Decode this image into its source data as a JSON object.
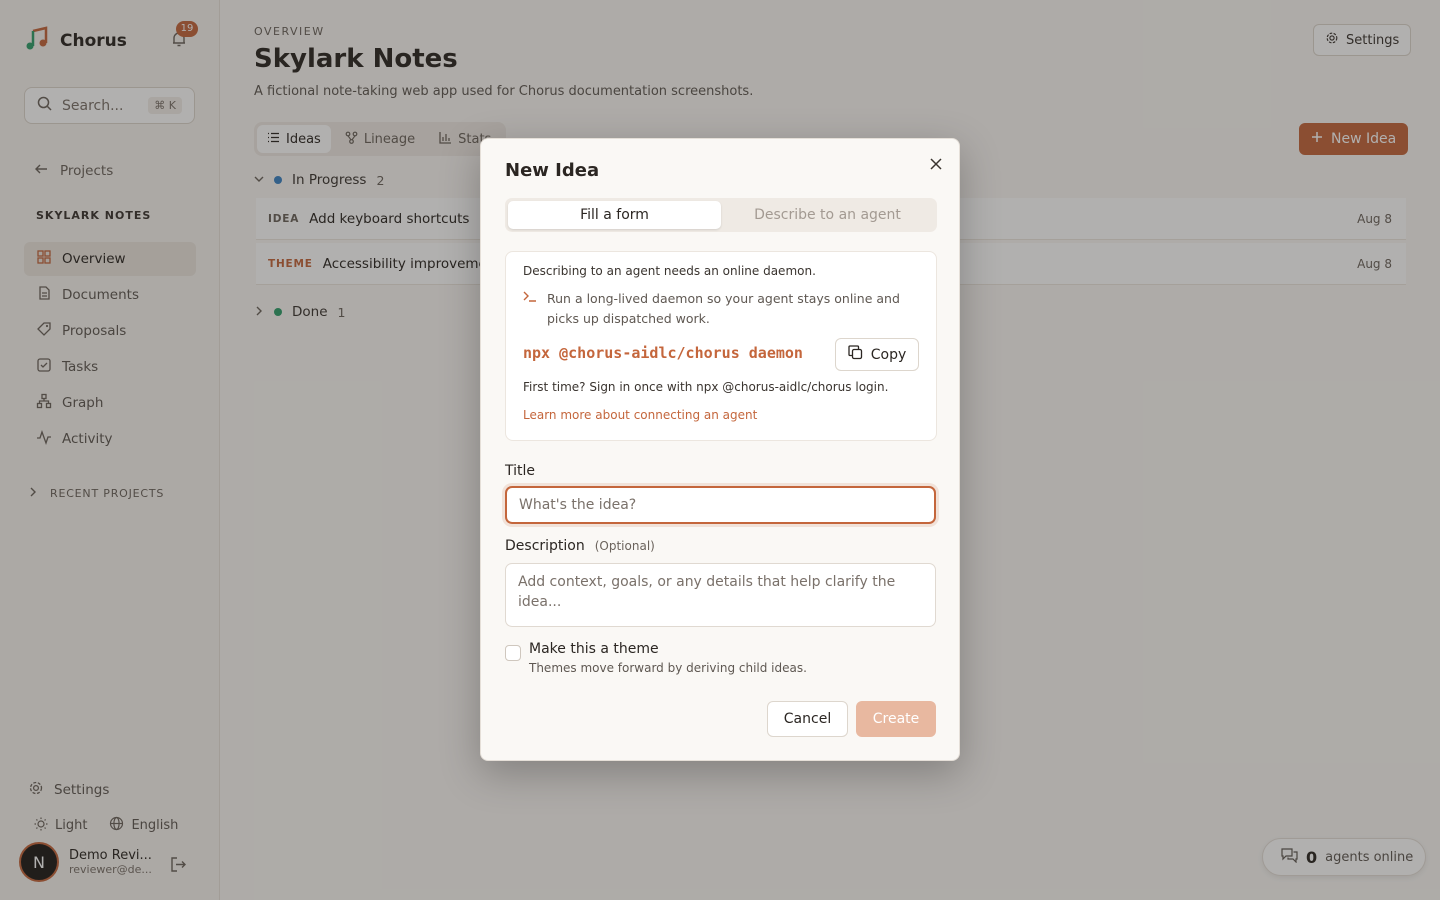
{
  "sidebar": {
    "app_name": "Chorus",
    "notification_count": "19",
    "search_label": "Search...",
    "search_shortcut": "⌘ K",
    "back_label": "Projects",
    "project_title": "SKYLARK NOTES",
    "items": [
      {
        "label": "Overview",
        "icon": "grid-icon",
        "active": true
      },
      {
        "label": "Documents",
        "icon": "document-icon"
      },
      {
        "label": "Proposals",
        "icon": "tag-icon"
      },
      {
        "label": "Tasks",
        "icon": "checkbox-icon"
      },
      {
        "label": "Graph",
        "icon": "graph-icon"
      },
      {
        "label": "Activity",
        "icon": "activity-icon"
      }
    ],
    "recent_label": "RECENT PROJECTS",
    "settings_label": "Settings",
    "theme_label": "Light",
    "language_label": "English",
    "user": {
      "initial": "N",
      "name": "Demo Revi...",
      "email": "reviewer@de..."
    }
  },
  "header": {
    "eyebrow": "OVERVIEW",
    "title": "Skylark Notes",
    "description": "A fictional note-taking web app used for Chorus documentation screenshots.",
    "settings_label": "Settings"
  },
  "tabs": [
    {
      "label": "Ideas",
      "icon": "list-icon",
      "active": true
    },
    {
      "label": "Lineage",
      "icon": "lineage-icon"
    },
    {
      "label": "Stats",
      "icon": "bar-chart-icon"
    }
  ],
  "new_idea_label": "New Idea",
  "groups": [
    {
      "label": "In Progress",
      "count": "2",
      "color": "#3b82c4"
    },
    {
      "label": "Done",
      "count": "1",
      "color": "#2f9e6b"
    }
  ],
  "rows": [
    {
      "tag": "IDEA",
      "tag_color": "#6b635c",
      "title": "Add keyboard shortcuts",
      "date": "Aug 8"
    },
    {
      "tag": "THEME",
      "tag_color": "#c4663c",
      "title": "Accessibility improveme",
      "date": "Aug 8"
    }
  ],
  "agents": {
    "count": "0",
    "label": "agents online"
  },
  "modal": {
    "title": "New Idea",
    "modes": [
      "Fill a form",
      "Describe to an agent"
    ],
    "daemon": {
      "note": "Describing to an agent needs an online daemon.",
      "run_text": "Run a long-lived daemon so your agent stays online and picks up dispatched work.",
      "command": "npx @chorus-aidlc/chorus daemon",
      "copy_label": "Copy",
      "first_time": "First time? Sign in once with npx @chorus-aidlc/chorus login.",
      "learn_more": "Learn more about connecting an agent"
    },
    "title_label": "Title",
    "title_placeholder": "What's the idea?",
    "description_label": "Description",
    "description_optional": "(Optional)",
    "description_placeholder": "Add context, goals, or any details that help clarify the idea...",
    "theme_label": "Make this a theme",
    "theme_help": "Themes move forward by deriving child ideas.",
    "cancel_label": "Cancel",
    "create_label": "Create"
  },
  "colors": {
    "accent": "#c4663c",
    "accent_disabled": "#e8b8a0"
  }
}
